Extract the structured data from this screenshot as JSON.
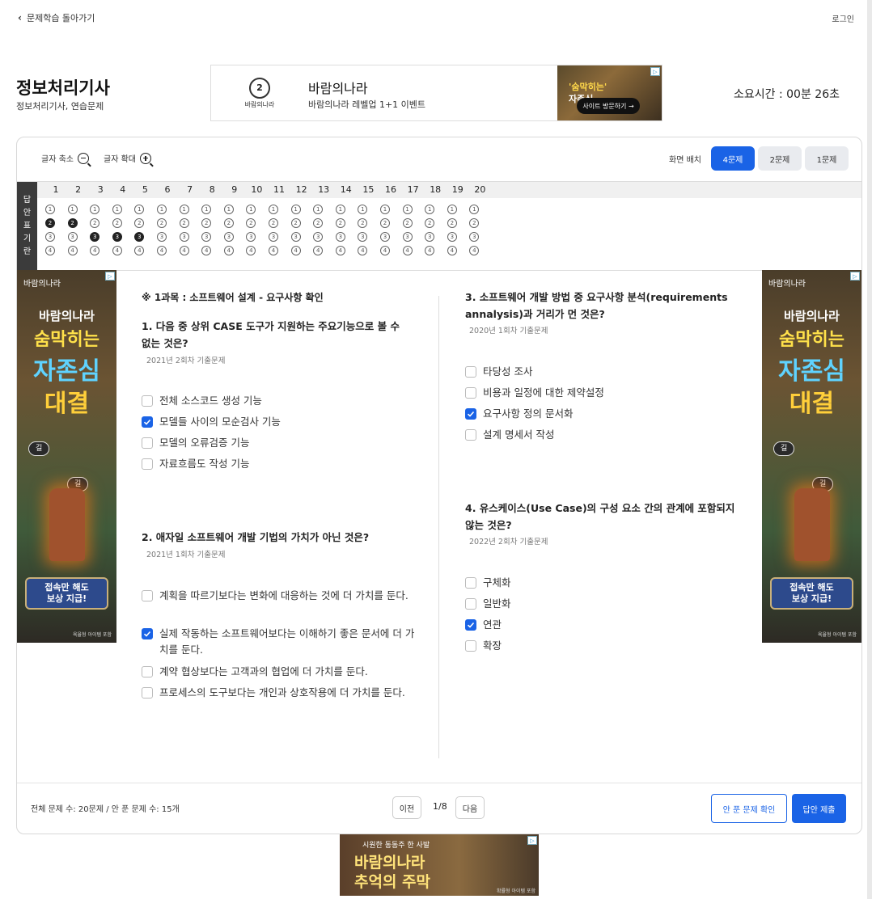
{
  "nav": {
    "back_label": "문제학습 돌아가기",
    "login_label": "로그인"
  },
  "exam": {
    "title": "정보처리기사",
    "subtitle": "정보처리기사, 연습문제",
    "timer": "소요시간 : 00분 26초"
  },
  "banner": {
    "logo_text": "바람의나라",
    "name": "바람의나라",
    "desc": "바람의나라 레벨업 1+1 이벤트",
    "img_line1": "'숨막히는'",
    "img_line2": "자존심",
    "cta": "사이트 방문하기 →"
  },
  "toolbar": {
    "zoom_out": "글자 축소",
    "zoom_in": "글자 확대",
    "layout_label": "화면 배치",
    "layouts": [
      "4문제",
      "2문제",
      "1문제"
    ],
    "active_layout": "4문제"
  },
  "omr": {
    "side_label": [
      "답",
      "안",
      "표",
      "기",
      "란"
    ],
    "numbers": [
      "1",
      "2",
      "3",
      "4",
      "5",
      "6",
      "7",
      "8",
      "9",
      "10",
      "11",
      "12",
      "13",
      "14",
      "15",
      "16",
      "17",
      "18",
      "19",
      "20"
    ],
    "choices": [
      "1",
      "2",
      "3",
      "4"
    ],
    "answers": [
      2,
      2,
      3,
      3,
      3,
      0,
      0,
      0,
      0,
      0,
      0,
      0,
      0,
      0,
      0,
      0,
      0,
      0,
      0,
      0
    ]
  },
  "side_ad": {
    "logo": "바람의나라",
    "line1": "바람의나라",
    "line2": "숨막히는",
    "line3": "자존심",
    "line4": "대결",
    "tag": "길",
    "cta_line1": "접속만 해도",
    "cta_line2": "보상 지급!",
    "fine": "육율형 아이템 포함"
  },
  "subject": "※ 1과목 : 소프트웨어 설계 - 요구사항 확인",
  "questions": [
    {
      "title": "1. 다음 중 상위 CASE 도구가 지원하는 주요기능으로 볼 수 없는 것은?",
      "year": "2021년 2회차 기출문제",
      "options": [
        "전체 소스코드 생성 기능",
        "모델들 사이의 모순검사 기능",
        "모델의 오류검증 기능",
        "자료흐름도 작성 기능"
      ],
      "selected": 1
    },
    {
      "title": "2. 애자일 소프트웨어 개발 기법의 가치가 아닌 것은?",
      "year": "2021년 1회차 기출문제",
      "options": [
        "계획을 따르기보다는 변화에 대응하는 것에 더 가치를 둔다.",
        "실제 작동하는 소프트웨어보다는 이해하기 좋은 문서에 더 가치를 둔다.",
        "계약 협상보다는 고객과의 협업에 더 가치를 둔다.",
        "프로세스의 도구보다는 개인과 상호작용에 더 가치를 둔다."
      ],
      "selected": 1
    },
    {
      "title": "3. 소프트웨어 개발 방법 중 요구사항 분석(requirements annalysis)과 거리가 먼 것은?",
      "year": "2020년 1회차 기출문제",
      "options": [
        "타당성 조사",
        "비용과 일정에 대한 제약설정",
        "요구사항 정의 문서화",
        "설계 명세서 작성"
      ],
      "selected": 2
    },
    {
      "title": "4. 유스케이스(Use Case)의 구성 요소 간의 관계에 포함되지 않는 것은?",
      "year": "2022년 2회차 기출문제",
      "options": [
        "구체화",
        "일반화",
        "연관",
        "확장"
      ],
      "selected": 2
    }
  ],
  "footer": {
    "count_text": "전체 문제 수: 20문제 / 안 푼 문제 수: 15개",
    "prev": "이전",
    "page": "1/8",
    "next": "다음",
    "unsolved": "안 푼 문제 확인",
    "submit": "답안 제출"
  },
  "bottom_ad": {
    "line1": "시원한 동동주 한 사발",
    "line2": "바람의나라",
    "line3": "추억의 주막",
    "fine": "확률형 아이템 포함"
  },
  "colors": {
    "accent": "#1a63e6"
  }
}
